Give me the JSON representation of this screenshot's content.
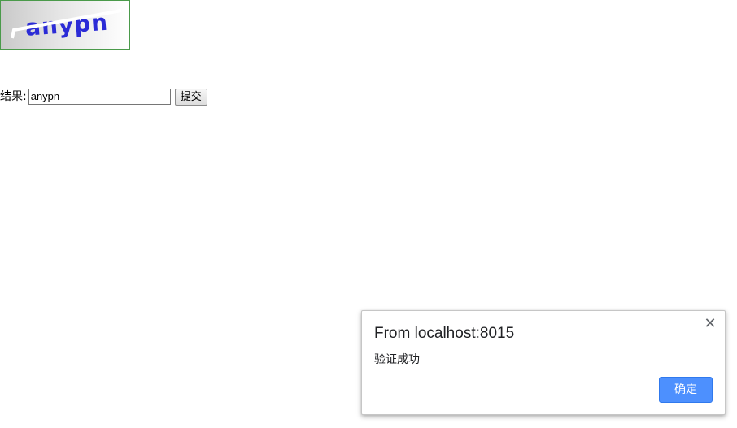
{
  "captcha": {
    "text": "anypn",
    "text_color": "#2b2bd6",
    "line_color": "#ffffff"
  },
  "form": {
    "label": "结果:",
    "input_value": "anypn",
    "submit_label": "提交"
  },
  "dialog": {
    "title": "From localhost:8015",
    "message": "验证成功",
    "ok_label": "确定",
    "close_glyph": "✕",
    "accent_color": "#4d90fe"
  }
}
